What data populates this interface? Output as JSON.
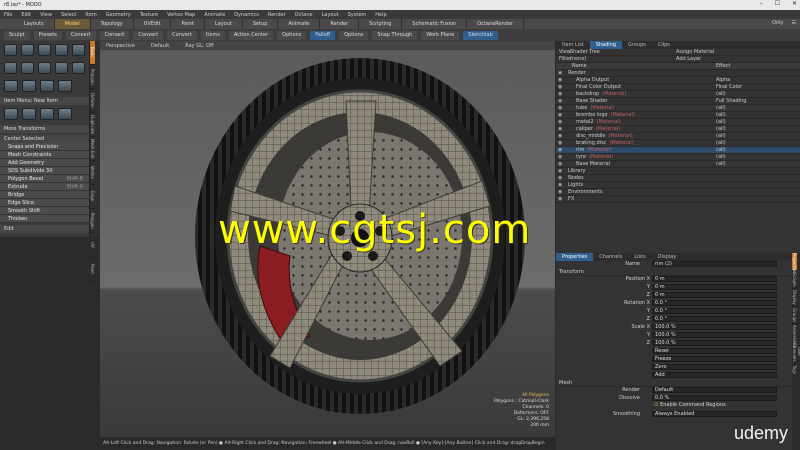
{
  "window": {
    "title": "r8.lxo* - MODO",
    "controls": [
      "–",
      "☐",
      "✕"
    ]
  },
  "menu": [
    "File",
    "Edit",
    "View",
    "Select",
    "Item",
    "Geometry",
    "Texture",
    "Vertex Map",
    "Animate",
    "Dynamics",
    "Render",
    "Octane",
    "Layout",
    "System",
    "Help"
  ],
  "tabs": [
    "Layouts",
    "Model",
    "Topology",
    "UVEdit",
    "Paint",
    "Layout",
    "Setup",
    "Animate",
    "Render",
    "Scripting",
    "Schematic Fusion",
    "OctaneRender"
  ],
  "active_tab": "Model",
  "tab_right": [
    "Only",
    "☰"
  ],
  "toolbar": [
    "Sculpt",
    "Presets",
    "Convert",
    "Convert",
    "Convert",
    "Convert",
    "Items",
    "Action Center",
    "Options",
    "Falloff",
    "Options",
    "Snap Through",
    "Work Plane",
    "Sketchlab"
  ],
  "left": {
    "menu_label": "Item Menu: New Item",
    "transforms": "More Transforms",
    "center": "Center Selected",
    "items": [
      {
        "label": "Snaps and Precision",
        "key": ""
      },
      {
        "label": "Mesh Constraints",
        "key": ""
      },
      {
        "label": "Add Geometry",
        "key": ""
      },
      {
        "label": "SDS Subdivide 3X",
        "key": ""
      },
      {
        "label": "Polygon Bevel",
        "key": "Shift-B"
      },
      {
        "label": "Extrude",
        "key": "Shift-X"
      },
      {
        "label": "Bridge",
        "key": ""
      },
      {
        "label": "Edge Slice",
        "key": ""
      },
      {
        "label": "Smooth Shift",
        "key": ""
      },
      {
        "label": "Thicken",
        "key": ""
      }
    ],
    "edit": "Edit",
    "side_tabs": [
      "Basic",
      "Polygon",
      "Deform",
      "Duplicate",
      "Mesh Edit",
      "Vertex",
      "Edge",
      "Polygon",
      "UV",
      "Paint"
    ]
  },
  "viewport": {
    "header": [
      "Perspective",
      "Default",
      "Ray GL: Off"
    ],
    "readout": {
      "mode": "All Polygons",
      "lines": [
        "Polygons : Catmull-Clark",
        "Channels: 0",
        "Deformers: OFF",
        "GL: 2,396,258",
        "200 mm"
      ]
    },
    "watermark": "www.cgtsj.com"
  },
  "status": "Alt-Left Click and Drag: Navigation: Rotate (or Pan) ● Alt-Right Click and Drag: Navigation: Freewheel ● Alt-Middle Click and Drag: navRoll ● [Any Key]-[Any Button] Click and Drag: dragDropBegin",
  "shader": {
    "tabs": [
      "Item List",
      "Shading",
      "Groups",
      "Clips"
    ],
    "view_label": "View",
    "view": "Shader Tree",
    "filter_label": "Filter",
    "filter": "(none)",
    "assign": "Assign Material",
    "add_layer": "Add Layer",
    "col_name": "Name",
    "col_effect": "Effect",
    "rows": [
      {
        "name": "Render",
        "effect": ""
      },
      {
        "name": "Alpha Output",
        "effect": "Alpha"
      },
      {
        "name": "Final Color Output",
        "effect": "Final Color"
      },
      {
        "name": "backdrop",
        "tag": "(Material)",
        "effect": "(all)"
      },
      {
        "name": "Base Shader",
        "effect": "Full Shading"
      },
      {
        "name": "tube",
        "tag": "(Material)",
        "effect": "(all)"
      },
      {
        "name": "brembo logo",
        "tag": "(Material)",
        "effect": "(all)"
      },
      {
        "name": "metal2",
        "tag": "(Material)",
        "effect": "(all)"
      },
      {
        "name": "caliper",
        "tag": "(Material)",
        "effect": "(all)"
      },
      {
        "name": "disc_middle",
        "tag": "(Material)",
        "effect": "(all)"
      },
      {
        "name": "braking disc",
        "tag": "(Material)",
        "effect": "(all)"
      },
      {
        "name": "rim",
        "tag": "(Material)",
        "effect": "(all)"
      },
      {
        "name": "tyre",
        "tag": "(Material)",
        "effect": "(all)"
      },
      {
        "name": "Base Material",
        "effect": "(all)"
      },
      {
        "name": "Library",
        "effect": ""
      },
      {
        "name": "Nodes",
        "effect": ""
      },
      {
        "name": "Lights",
        "effect": ""
      },
      {
        "name": "Environments",
        "effect": ""
      },
      {
        "name": "FX",
        "effect": ""
      }
    ]
  },
  "properties": {
    "tabs": [
      "Properties",
      "Channels",
      "Lists",
      "Display"
    ],
    "name_label": "Name",
    "name": "rim (2)",
    "transform": "Transform",
    "fields": [
      {
        "label": "Position X",
        "value": "0 m"
      },
      {
        "label": "Y",
        "value": "0 m"
      },
      {
        "label": "Z",
        "value": "0 m"
      },
      {
        "label": "Rotation X",
        "value": "0.0 °"
      },
      {
        "label": "Y",
        "value": "0.0 °"
      },
      {
        "label": "Z",
        "value": "0.0 °"
      },
      {
        "label": "Scale X",
        "value": "100.0 %"
      },
      {
        "label": "Y",
        "value": "100.0 %"
      },
      {
        "label": "Z",
        "value": "100.0 %"
      }
    ],
    "buttons": [
      "Reset",
      "Freeze",
      "Zero",
      "Add"
    ],
    "mesh": "Mesh",
    "render_label": "Render",
    "render": "Default",
    "dissolve_label": "Dissolve",
    "dissolve": "0.0 %",
    "enable_label": "Enable Command Regions",
    "smoothing_label": "Smoothing",
    "smoothing": "Always Enabled",
    "side_tabs": [
      "Properties",
      "Scripts",
      "Display",
      "Groups",
      "Assemblies",
      "User Channels",
      "Tags"
    ]
  },
  "udemy": "udemy"
}
